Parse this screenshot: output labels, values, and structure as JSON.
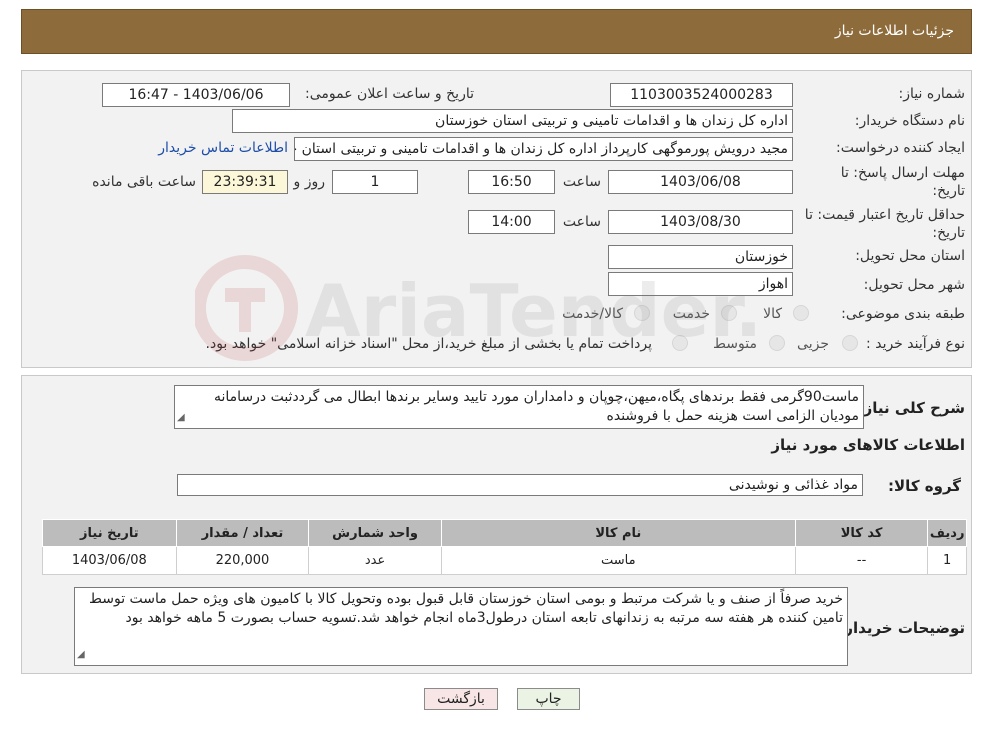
{
  "header": {
    "title": "جزئیات اطلاعات نیاز"
  },
  "form": {
    "need_number_label": "شماره نیاز:",
    "need_number": "1103003524000283",
    "announce_label": "تاریخ و ساعت اعلان عمومی:",
    "announce_value": "1403/06/06 - 16:47",
    "buyer_org_label": "نام دستگاه خریدار:",
    "buyer_org": "اداره کل زندان ها و اقدامات تامینی و تربیتی استان خوزستان",
    "requester_label": "ایجاد کننده درخواست:",
    "requester": "مجید درویش پورموگهی کارپرداز اداره کل زندان ها و اقدامات تامینی و تربیتی استان خوزستان",
    "contact_link": "اطلاعات تماس خریدار",
    "reply_deadline_label_1": "مهلت ارسال پاسخ: تا",
    "reply_deadline_label_2": "تاریخ:",
    "reply_date": "1403/06/08",
    "time_label": "ساعت",
    "reply_time": "16:50",
    "days_value": "1",
    "days_label": "روز و",
    "remaining_time": "23:39:31",
    "remaining_label": "ساعت باقی مانده",
    "price_validity_label_1": "حداقل تاریخ اعتبار قیمت: تا",
    "price_validity_label_2": "تاریخ:",
    "price_date": "1403/08/30",
    "price_time": "14:00",
    "province_label": "استان محل تحویل:",
    "province": "خوزستان",
    "city_label": "شهر محل تحویل:",
    "city": "اهواز",
    "category_label": "طبقه بندی موضوعی:",
    "category_options": [
      "کالا",
      "خدمت",
      "کالا/خدمت"
    ],
    "process_label": "نوع فرآیند خرید :",
    "process_options": [
      "جزیی",
      "متوسط"
    ],
    "process_note": "پرداخت تمام یا بخشی از مبلغ خرید،از محل \"اسناد خزانه اسلامی\" خواهد بود."
  },
  "details": {
    "description_label": "شرح کلی نیاز:",
    "description": "ماست90گرمی فقط برندهای پگاه،میهن،چوپان و دامداران مورد تایید وسایر برندها ابطال می گرددثبت درسامانه مودیان الزامی است هزینه حمل با فروشنده",
    "goods_info_title": "اطلاعات کالاهای مورد نیاز",
    "goods_group_label": "گروه کالا:",
    "goods_group": "مواد غذائی و نوشیدنی",
    "table": {
      "headers": [
        "ردیف",
        "کد کالا",
        "نام کالا",
        "واحد شمارش",
        "تعداد / مقدار",
        "تاریخ نیاز"
      ],
      "rows": [
        [
          "1",
          "--",
          "ماست",
          "عدد",
          "220,000",
          "1403/06/08"
        ]
      ]
    },
    "buyer_notes_label": "توضیحات خریدار:",
    "buyer_notes": "خرید صرفاً از صنف و یا شرکت مرتبط  و بومی استان خوزستان قابل قبول بوده وتحویل کالا با کامیون های ویژه حمل ماست توسط تامین کننده هر هفته سه مرتبه به زندانهای تابعه استان درطول3ماه انجام خواهد شد.تسویه حساب بصورت 5 ماهه خواهد بود"
  },
  "buttons": {
    "print": "چاپ",
    "back": "بازگشت"
  },
  "watermark": "AriaTender.neT",
  "colors": {
    "header_bg": "#8d6b3b",
    "panel_bg": "#f2f2f2",
    "link": "#1d4ea8",
    "table_header": "#bcbcbc"
  }
}
